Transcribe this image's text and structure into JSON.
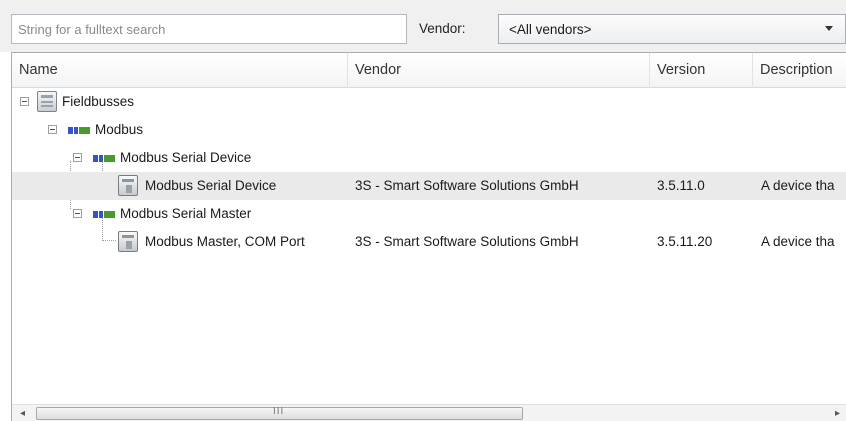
{
  "search": {
    "placeholder": "String for a fulltext search",
    "value": ""
  },
  "vendor_filter": {
    "label": "Vendor:",
    "selected": "<All vendors>",
    "arrow_icon": "chevron-down-icon"
  },
  "columns": {
    "name": "Name",
    "vendor": "Vendor",
    "version": "Version",
    "description": "Description"
  },
  "tree": {
    "fieldbusses": {
      "label": "Fieldbusses",
      "icon": "folder-icon"
    },
    "modbus": {
      "label": "Modbus",
      "icon": "fieldbus-icon"
    },
    "serial_device_group": {
      "label": "Modbus Serial Device",
      "icon": "fieldbus-icon"
    },
    "serial_device": {
      "label": "Modbus Serial Device",
      "icon": "device-icon",
      "vendor": "3S - Smart Software Solutions GmbH",
      "version": "3.5.11.0",
      "description": "A device tha",
      "selected": true
    },
    "serial_master_group": {
      "label": "Modbus Serial Master",
      "icon": "fieldbus-icon"
    },
    "master_com_port": {
      "label": "Modbus Master, COM Port",
      "icon": "device-icon",
      "vendor": "3S - Smart Software Solutions GmbH",
      "version": "3.5.11.20",
      "description": "A device tha",
      "selected": false
    }
  },
  "scrollbar": {
    "left_arrow": "◂",
    "right_arrow": "▸",
    "grip": "III"
  },
  "colors": {
    "selection": "#eaeaea",
    "bus_blue": "#3554c8",
    "bus_green": "#4a9a2c"
  }
}
